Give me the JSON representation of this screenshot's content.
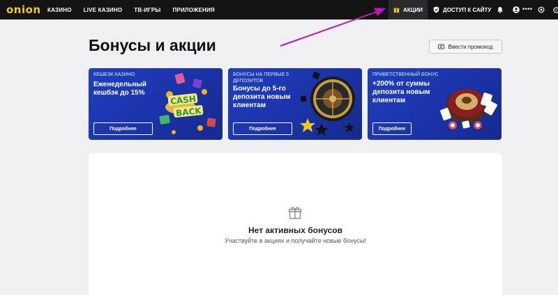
{
  "brand": {
    "logo_text": "onion",
    "accent": "#f2c919"
  },
  "nav": {
    "items": [
      {
        "label": "КАЗИНО"
      },
      {
        "label": "LIVE КАЗИНО"
      },
      {
        "label": "ТВ-ИГРЫ"
      },
      {
        "label": "ПРИЛОЖЕНИЯ"
      }
    ],
    "promotions_label": "АКЦИИ",
    "site_access_label": "ДОСТУП К САЙТУ",
    "user_masked": "****"
  },
  "page": {
    "title": "Бонусы и акции",
    "promo_button_label": "Ввести промокод"
  },
  "cards": [
    {
      "category": "КЕШБЭК КАЗИНО",
      "headline": "Еженедельный кешбэк до 15%",
      "button": "Подробнее",
      "art": "cashback-art"
    },
    {
      "category": "БОНУСЫ НА ПЕРВЫЕ 5 ДЕПОЗИТОВ",
      "headline": "Бонусы до 5-го депозита новым клиентам",
      "button": "Подробнее",
      "art": "roulette-art"
    },
    {
      "category": "ПРИВЕТСТВЕННЫЙ БОНУС",
      "headline": "+200% от суммы депозита новым клиентам",
      "button": "Подробнее",
      "art": "casino-chips-art"
    }
  ],
  "cashback_art_text": {
    "line1": "CASH",
    "line2": "BACK"
  },
  "empty_state": {
    "title": "Нет активных бонусов",
    "subtitle": "Участвуйте в акциях и получайте новые бонусы!",
    "icon": "gift-icon"
  },
  "colors": {
    "card_blue": "#1f3fbf",
    "topbar": "#141414",
    "arrow": "#b51bb5"
  }
}
